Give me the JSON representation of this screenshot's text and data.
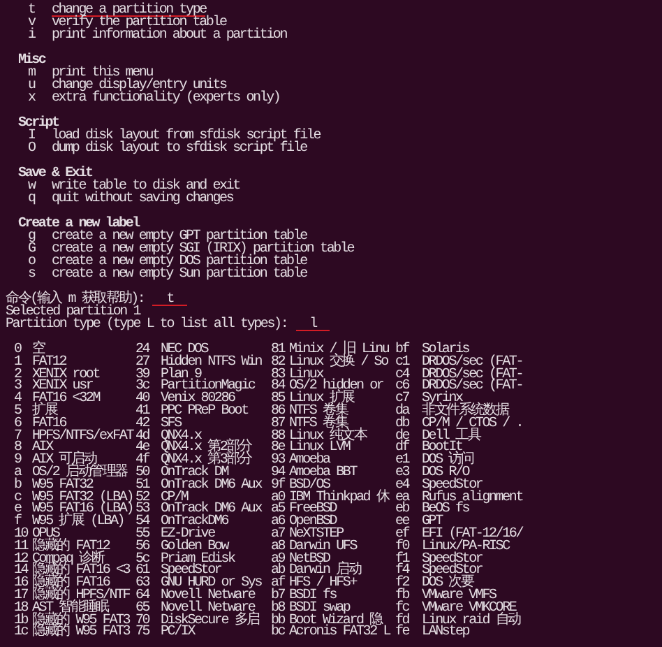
{
  "menu": [
    {
      "commands": [
        {
          "key": "t",
          "text": "change a partition type",
          "underlined": true
        },
        {
          "key": "v",
          "text": "verify the partition table",
          "underlined": false
        },
        {
          "key": "i",
          "text": "print information about a partition",
          "underlined": false
        }
      ]
    },
    {
      "heading": "Misc",
      "commands": [
        {
          "key": "m",
          "text": "print this menu",
          "underlined": false
        },
        {
          "key": "u",
          "text": "change display/entry units",
          "underlined": false
        },
        {
          "key": "x",
          "text": "extra functionality (experts only)",
          "underlined": false
        }
      ]
    },
    {
      "heading": "Script",
      "commands": [
        {
          "key": "I",
          "text": "load disk layout from sfdisk script file",
          "underlined": false
        },
        {
          "key": "O",
          "text": "dump disk layout to sfdisk script file",
          "underlined": false
        }
      ]
    },
    {
      "heading": "Save & Exit",
      "commands": [
        {
          "key": "w",
          "text": "write table to disk and exit",
          "underlined": false
        },
        {
          "key": "q",
          "text": "quit without saving changes",
          "underlined": false
        }
      ]
    },
    {
      "heading": "Create a new label",
      "commands": [
        {
          "key": "g",
          "text": "create a new empty GPT partition table",
          "underlined": false
        },
        {
          "key": "G",
          "text": "create a new empty SGI (IRIX) partition table",
          "underlined": false
        },
        {
          "key": "o",
          "text": "create a new empty DOS partition table",
          "underlined": false
        },
        {
          "key": "s",
          "text": "create a new empty Sun partition table",
          "underlined": false
        }
      ]
    }
  ],
  "prompts": [
    {
      "text": "命令(输入 m 获取帮助):",
      "answer": "t",
      "underlined": true
    },
    {
      "text": "Selected partition 1"
    },
    {
      "text": "Partition type (type L to list all types):",
      "answer": "l",
      "underlined": true
    }
  ],
  "partition_types": [
    {
      "code": "0",
      "name": "空"
    },
    {
      "code": "1",
      "name": "FAT12"
    },
    {
      "code": "2",
      "name": "XENIX root"
    },
    {
      "code": "3",
      "name": "XENIX usr"
    },
    {
      "code": "4",
      "name": "FAT16 <32M"
    },
    {
      "code": "5",
      "name": "扩展"
    },
    {
      "code": "6",
      "name": "FAT16"
    },
    {
      "code": "7",
      "name": "HPFS/NTFS/exFAT"
    },
    {
      "code": "8",
      "name": "AIX"
    },
    {
      "code": "9",
      "name": "AIX 可启动"
    },
    {
      "code": "a",
      "name": "OS/2 启动管理器"
    },
    {
      "code": "b",
      "name": "W95 FAT32"
    },
    {
      "code": "c",
      "name": "W95 FAT32 (LBA)"
    },
    {
      "code": "e",
      "name": "W95 FAT16 (LBA)"
    },
    {
      "code": "f",
      "name": "W95 扩展 (LBA)"
    },
    {
      "code": "10",
      "name": "OPUS"
    },
    {
      "code": "11",
      "name": "隐藏的 FAT12"
    },
    {
      "code": "12",
      "name": "Compaq 诊断"
    },
    {
      "code": "14",
      "name": "隐藏的 FAT16 <3"
    },
    {
      "code": "16",
      "name": "隐藏的 FAT16"
    },
    {
      "code": "17",
      "name": "隐藏的 HPFS/NTF"
    },
    {
      "code": "18",
      "name": "AST 智能睡眠"
    },
    {
      "code": "1b",
      "name": "隐藏的 W95 FAT3"
    },
    {
      "code": "1c",
      "name": "隐藏的 W95 FAT3"
    },
    {
      "code": "24",
      "name": "NEC DOS"
    },
    {
      "code": "27",
      "name": "Hidden NTFS Win"
    },
    {
      "code": "39",
      "name": "Plan 9"
    },
    {
      "code": "3c",
      "name": "PartitionMagic"
    },
    {
      "code": "40",
      "name": "Venix 80286"
    },
    {
      "code": "41",
      "name": "PPC PReP Boot"
    },
    {
      "code": "42",
      "name": "SFS"
    },
    {
      "code": "4d",
      "name": "QNX4.x"
    },
    {
      "code": "4e",
      "name": "QNX4.x 第2部分"
    },
    {
      "code": "4f",
      "name": "QNX4.x 第3部分"
    },
    {
      "code": "50",
      "name": "OnTrack DM"
    },
    {
      "code": "51",
      "name": "OnTrack DM6 Aux"
    },
    {
      "code": "52",
      "name": "CP/M"
    },
    {
      "code": "53",
      "name": "OnTrack DM6 Aux"
    },
    {
      "code": "54",
      "name": "OnTrackDM6"
    },
    {
      "code": "55",
      "name": "EZ-Drive"
    },
    {
      "code": "56",
      "name": "Golden Bow"
    },
    {
      "code": "5c",
      "name": "Priam Edisk"
    },
    {
      "code": "61",
      "name": "SpeedStor"
    },
    {
      "code": "63",
      "name": "GNU HURD or Sys"
    },
    {
      "code": "64",
      "name": "Novell Netware"
    },
    {
      "code": "65",
      "name": "Novell Netware"
    },
    {
      "code": "70",
      "name": "DiskSecure 多启"
    },
    {
      "code": "75",
      "name": "PC/IX"
    },
    {
      "code": "81",
      "name": "Minix / 旧 Linu"
    },
    {
      "code": "82",
      "name": "Linux 交换 / So"
    },
    {
      "code": "83",
      "name": "Linux"
    },
    {
      "code": "84",
      "name": "OS/2 hidden or"
    },
    {
      "code": "85",
      "name": "Linux 扩展"
    },
    {
      "code": "86",
      "name": "NTFS 卷集"
    },
    {
      "code": "87",
      "name": "NTFS 卷集"
    },
    {
      "code": "88",
      "name": "Linux 纯文本"
    },
    {
      "code": "8e",
      "name": "Linux LVM"
    },
    {
      "code": "93",
      "name": "Amoeba"
    },
    {
      "code": "94",
      "name": "Amoeba BBT"
    },
    {
      "code": "9f",
      "name": "BSD/OS"
    },
    {
      "code": "a0",
      "name": "IBM Thinkpad 休"
    },
    {
      "code": "a5",
      "name": "FreeBSD"
    },
    {
      "code": "a6",
      "name": "OpenBSD"
    },
    {
      "code": "a7",
      "name": "NeXTSTEP"
    },
    {
      "code": "a8",
      "name": "Darwin UFS"
    },
    {
      "code": "a9",
      "name": "NetBSD"
    },
    {
      "code": "ab",
      "name": "Darwin 启动"
    },
    {
      "code": "af",
      "name": "HFS / HFS+"
    },
    {
      "code": "b7",
      "name": "BSDI fs"
    },
    {
      "code": "b8",
      "name": "BSDI swap"
    },
    {
      "code": "bb",
      "name": "Boot Wizard 隐"
    },
    {
      "code": "bc",
      "name": "Acronis FAT32 L"
    },
    {
      "code": "bf",
      "name": "Solaris"
    },
    {
      "code": "c1",
      "name": "DRDOS/sec (FAT-"
    },
    {
      "code": "c4",
      "name": "DRDOS/sec (FAT-"
    },
    {
      "code": "c6",
      "name": "DRDOS/sec (FAT-"
    },
    {
      "code": "c7",
      "name": "Syrinx"
    },
    {
      "code": "da",
      "name": "非文件系统数据"
    },
    {
      "code": "db",
      "name": "CP/M / CTOS / ."
    },
    {
      "code": "de",
      "name": "Dell 工具"
    },
    {
      "code": "df",
      "name": "BootIt"
    },
    {
      "code": "e1",
      "name": "DOS 访问"
    },
    {
      "code": "e3",
      "name": "DOS R/O"
    },
    {
      "code": "e4",
      "name": "SpeedStor"
    },
    {
      "code": "ea",
      "name": "Rufus alignment"
    },
    {
      "code": "eb",
      "name": "BeOS fs"
    },
    {
      "code": "ee",
      "name": "GPT"
    },
    {
      "code": "ef",
      "name": "EFI (FAT-12/16/"
    },
    {
      "code": "f0",
      "name": "Linux/PA-RISC"
    },
    {
      "code": "f1",
      "name": "SpeedStor"
    },
    {
      "code": "f4",
      "name": "SpeedStor"
    },
    {
      "code": "f2",
      "name": "DOS 次要"
    },
    {
      "code": "fb",
      "name": "VMware VMFS"
    },
    {
      "code": "fc",
      "name": "VMware VMKCORE"
    },
    {
      "code": "fd",
      "name": "Linux raid 自动"
    },
    {
      "code": "fe",
      "name": "LANstep"
    }
  ]
}
